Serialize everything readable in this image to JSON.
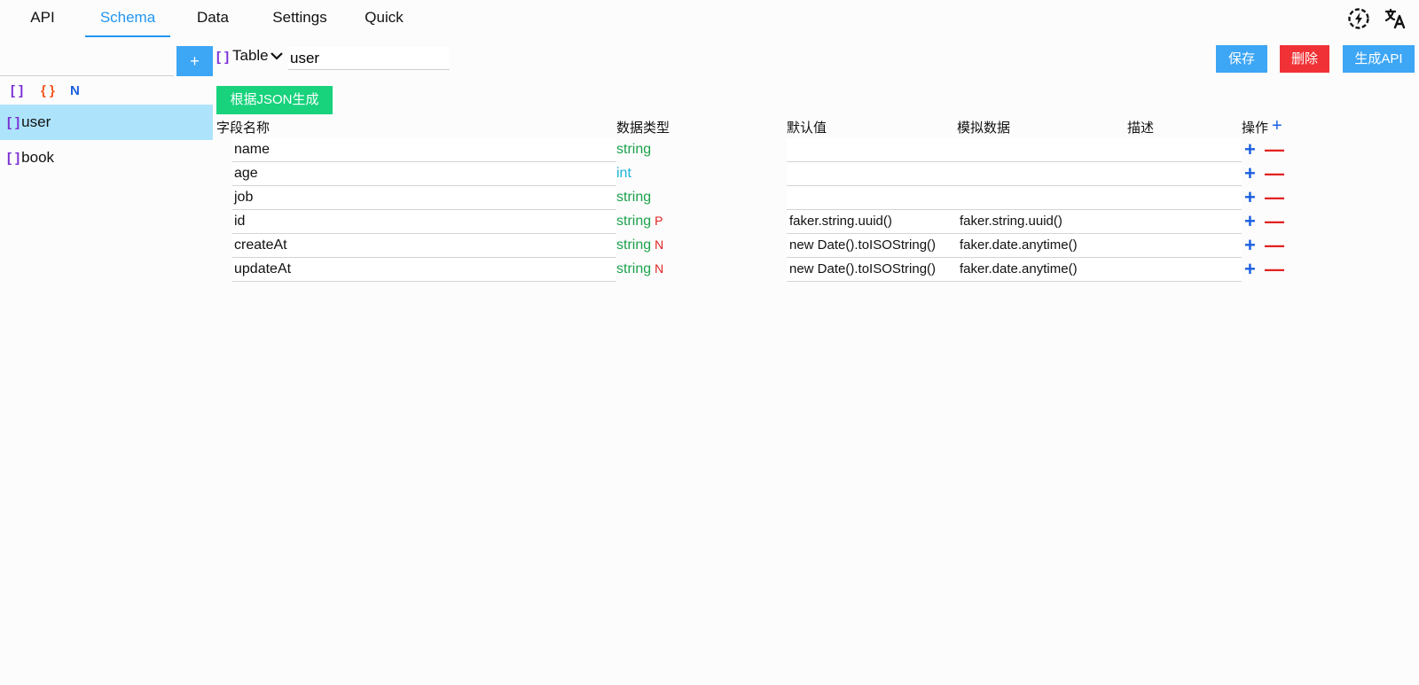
{
  "nav": {
    "tabs": [
      {
        "label": "API"
      },
      {
        "label": "Schema"
      },
      {
        "label": "Data"
      },
      {
        "label": "Settings"
      },
      {
        "label": "Quick"
      }
    ],
    "active_tab": "Schema"
  },
  "icons": {
    "left_icon": "bolt-circle-icon",
    "right_icon": "translate-icon"
  },
  "sidebar": {
    "new_name_value": "",
    "add_label": "+",
    "filters": [
      {
        "label": "[ ]",
        "color": "#7b2fd6"
      },
      {
        "label": "{ }",
        "color": "#f2541b"
      },
      {
        "label": "N",
        "color": "#1a5fe0"
      }
    ],
    "items": [
      {
        "bracket": "[ ]",
        "label": "user",
        "selected": true
      },
      {
        "bracket": "[ ]",
        "label": "book",
        "selected": false
      }
    ]
  },
  "toolbar": {
    "bracket": "[ ]",
    "kind": "Table",
    "schema_name": "user",
    "save_label": "保存",
    "delete_label": "删除",
    "generate_api_label": "生成API",
    "from_json_label": "根据JSON生成"
  },
  "table": {
    "headers": {
      "name": "字段名称",
      "type": "数据类型",
      "default": "默认值",
      "mock": "模拟数据",
      "desc": "描述",
      "ops": "操作"
    },
    "add_label": "+",
    "rows": [
      {
        "name": "name",
        "type": "string",
        "flag": "",
        "default": "",
        "mock": "",
        "desc": ""
      },
      {
        "name": "age",
        "type": "int",
        "flag": "",
        "default": "",
        "mock": "",
        "desc": ""
      },
      {
        "name": "job",
        "type": "string",
        "flag": "",
        "default": "",
        "mock": "",
        "desc": ""
      },
      {
        "name": "id",
        "type": "string",
        "flag": "P",
        "default": "faker.string.uuid()",
        "mock": "faker.string.uuid()",
        "desc": ""
      },
      {
        "name": "createAt",
        "type": "string",
        "flag": "N",
        "default": "new Date().toISOString()",
        "mock": "faker.date.anytime()",
        "desc": ""
      },
      {
        "name": "updateAt",
        "type": "string",
        "flag": "N",
        "default": "new Date().toISOString()",
        "mock": "faker.date.anytime()",
        "desc": ""
      }
    ],
    "row_add_label": "+",
    "row_del_label": "—"
  },
  "colors": {
    "accent": "#2196f3",
    "save": "#3da6f5",
    "delete": "#f03236",
    "from_json": "#18d27c",
    "string_type": "#1ca24c",
    "int_type": "#1ab5d8",
    "selected_bg": "#aee4fb"
  }
}
